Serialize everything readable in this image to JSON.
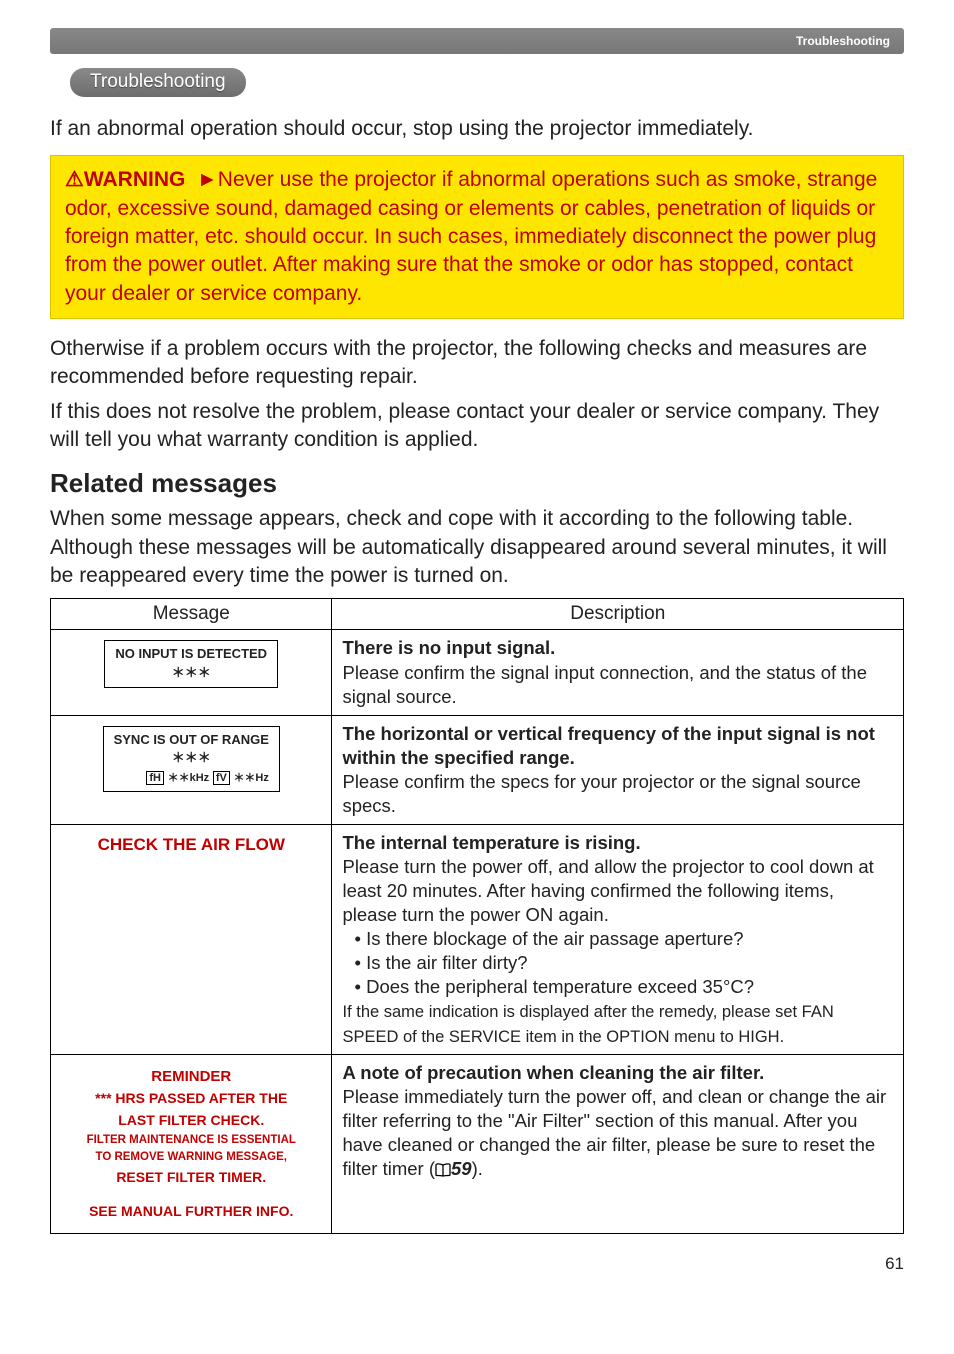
{
  "header": {
    "breadcrumb": "Troubleshooting"
  },
  "section_title": "Troubleshooting",
  "intro": "If an abnormal operation should occur, stop using the projector immediately.",
  "warning": {
    "label": "⚠WARNING",
    "arrow": "►",
    "text": "Never use the projector if abnormal operations such as smoke, strange odor, excessive sound, damaged casing or elements or cables, penetration of liquids or foreign matter, etc. should occur. In such cases, immediately disconnect the power plug from the power outlet. After making sure that the smoke or odor has stopped, contact your dealer or service company."
  },
  "otherwise_p1": "Otherwise if a problem occurs with the projector, the following checks and measures are recommended before requesting repair.",
  "otherwise_p2": "If this does not resolve the problem, please contact your dealer or service company. They will tell you what warranty condition is applied.",
  "related_heading": "Related messages",
  "related_intro": "When some message appears, check and cope with it according to the following table. Although these messages will be automatically disappeared around several minutes, it will be reappeared every time the power is turned on.",
  "table": {
    "col_message": "Message",
    "col_description": "Description",
    "rows": [
      {
        "msg": {
          "line1": "NO INPUT IS DETECTED",
          "line2": "＊＊＊"
        },
        "desc_bold": "There is no input signal.",
        "desc_rest": "Please confirm the signal input connection, and the status of the signal source."
      },
      {
        "msg": {
          "line1": "SYNC IS OUT OF RANGE",
          "line2": "＊＊＊",
          "freq_fh_label": "fH",
          "freq_fh_val": "＊＊kHz",
          "freq_fv_label": "fV",
          "freq_fv_val": "＊＊Hz"
        },
        "desc_bold": "The horizontal or vertical frequency of the input signal is not within the specified range.",
        "desc_rest": "Please confirm the specs for your projector or the signal source specs."
      },
      {
        "msg_plain": "CHECK THE AIR FLOW",
        "desc_bold": "The internal temperature is rising.",
        "desc_rest_p1": "Please turn the power off, and allow the projector to cool down at least 20 minutes. After having confirmed the following items, please turn the power ON again.",
        "bullets": [
          "• Is there blockage of the air passage aperture?",
          "• Is the air filter dirty?",
          "• Does the peripheral temperature exceed 35°C?"
        ],
        "desc_rest_p2": "If the same indication is displayed after the remedy, please set FAN SPEED of the SERVICE item in the OPTION menu to HIGH."
      },
      {
        "reminder": {
          "l1": "REMINDER",
          "l2": "*** HRS PASSED AFTER THE",
          "l3": "LAST FILTER CHECK.",
          "l4": "FILTER MAINTENANCE IS ESSENTIAL",
          "l5": "TO REMOVE WARNING MESSAGE,",
          "l6": "RESET FILTER TIMER.",
          "l7": "SEE MANUAL FURTHER INFO."
        },
        "desc_bold": "A note of precaution when cleaning the air filter.",
        "desc_rest_a": "Please immediately turn the power off, and clean or change the air filter referring to the \"Air Filter\" section of this manual. After you have cleaned or changed the air filter, please be sure to reset the filter timer (",
        "desc_ref": "59",
        "desc_rest_b": ")."
      }
    ]
  },
  "page_number": "61"
}
